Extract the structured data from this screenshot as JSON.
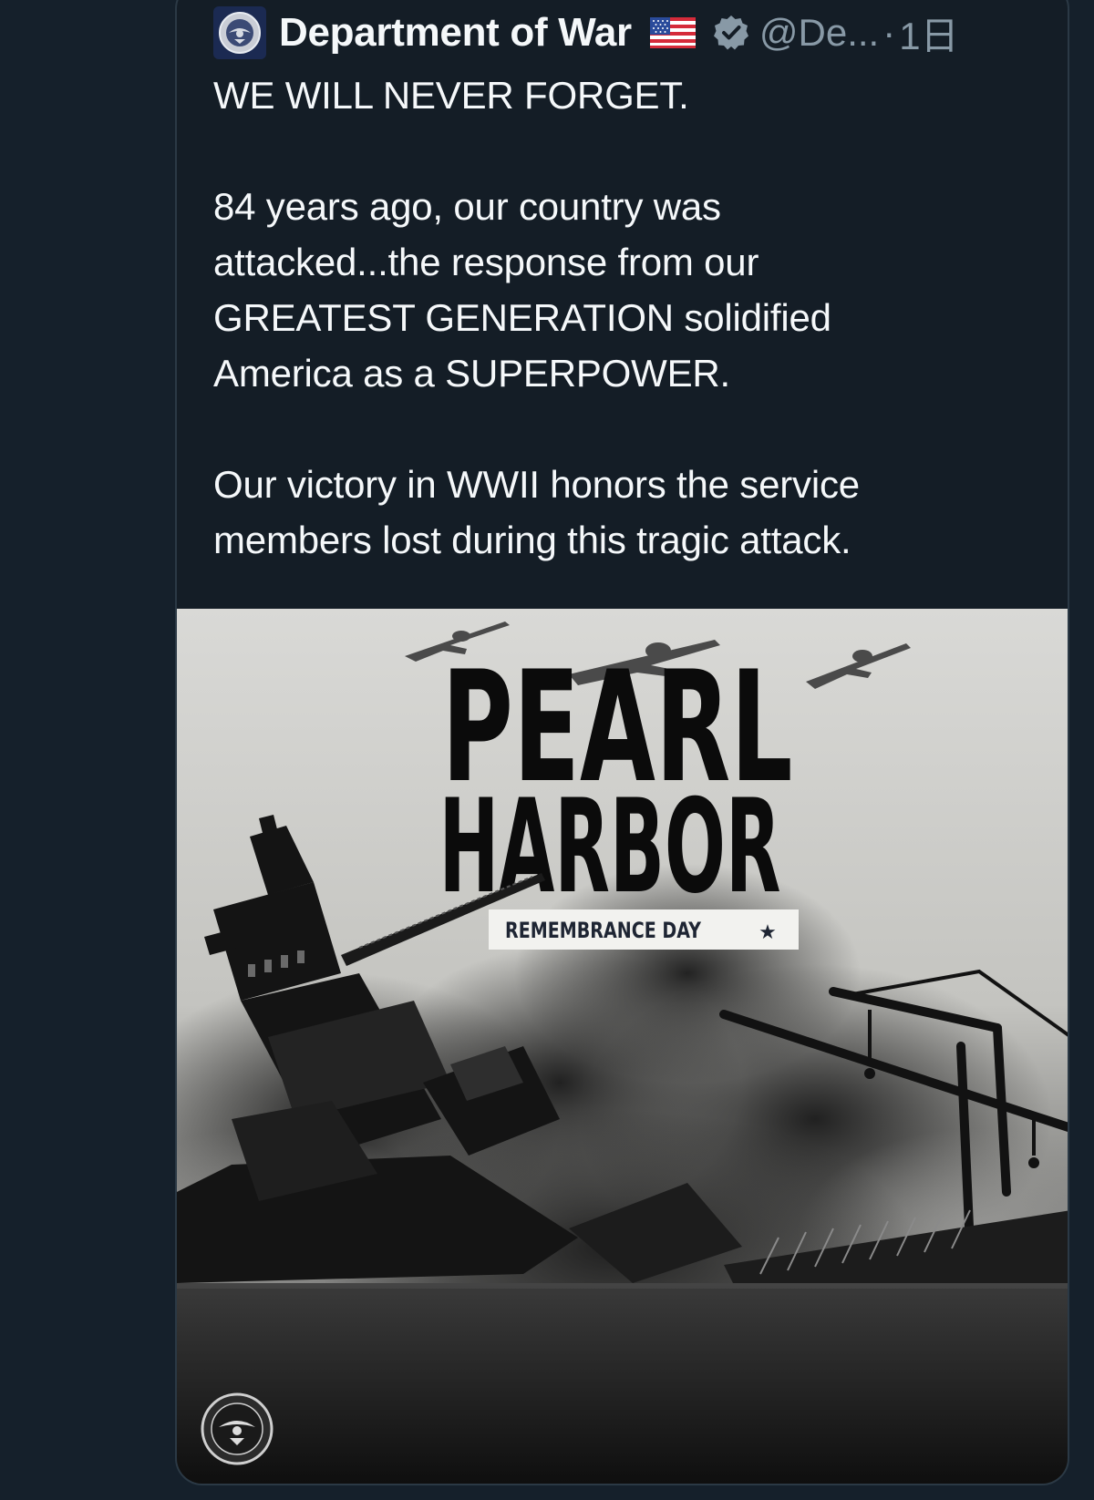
{
  "post": {
    "author": {
      "display_name": "Department of War",
      "handle": "@De...",
      "separator": "·",
      "time": "1日",
      "flag_icon": "us-flag-icon",
      "verified_icon": "verified-badge-icon",
      "avatar_icon": "department-seal-icon"
    },
    "text": {
      "line_1": "WE WILL NEVER FORGET.",
      "paragraph_2_lines": [
        "84 years ago, our country was",
        "attacked...the response from our",
        "GREATEST GENERATION solidified",
        "America as a SUPERPOWER."
      ],
      "paragraph_3_lines": [
        "Our victory in WWII honors the service",
        "members lost during this tragic attack."
      ]
    },
    "media": {
      "title_line_1": "PEARL",
      "title_line_2": "HARBOR",
      "subtitle": "REMEMBRANCE DAY",
      "star": "★",
      "seal_icon": "department-seal-icon"
    }
  },
  "colors": {
    "background": "#15202b",
    "card": "#141d26",
    "text": "#f5f8fa",
    "muted": "#8899a6"
  }
}
